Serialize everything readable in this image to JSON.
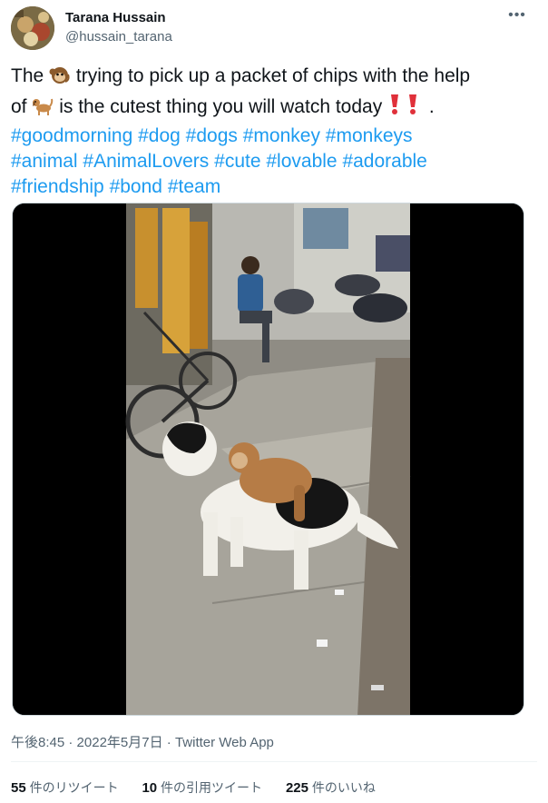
{
  "author": {
    "name": "Tarana Hussain",
    "handle": "@hussain_tarana",
    "avatar_icon": "avatar-photo"
  },
  "more_icon": "more-horizontal-icon",
  "tweet": {
    "w1": "The ",
    "w2": " trying to pick up a packet of chips with the help",
    "w3": "of ",
    "w4": " is the cutest thing you will watch today ",
    "w5": " .",
    "hashtags": [
      "#goodmorning",
      "#dog",
      "#dogs",
      "#monkey",
      "#monkeys",
      "#animal",
      "#AnimalLovers",
      "#cute",
      "#lovable",
      "#adorable",
      "#friendship",
      "#bond",
      "#team"
    ],
    "emoji_icons": [
      "monkey-emoji",
      "dog-emoji",
      "exclamation-emoji"
    ]
  },
  "media": {
    "type": "video",
    "description_icon": "video-thumbnail"
  },
  "meta": {
    "time": "午後8:45",
    "sep1": " · ",
    "date": "2022年5月7日",
    "sep2": " · ",
    "source": "Twitter Web App"
  },
  "stats": [
    {
      "count": "55",
      "label": " 件のリツイート"
    },
    {
      "count": "10",
      "label": " 件の引用ツイート"
    },
    {
      "count": "225",
      "label": " 件のいいね"
    }
  ],
  "colors": {
    "link": "#1d9bf0",
    "text": "#0f1419",
    "secondary": "#536471"
  }
}
